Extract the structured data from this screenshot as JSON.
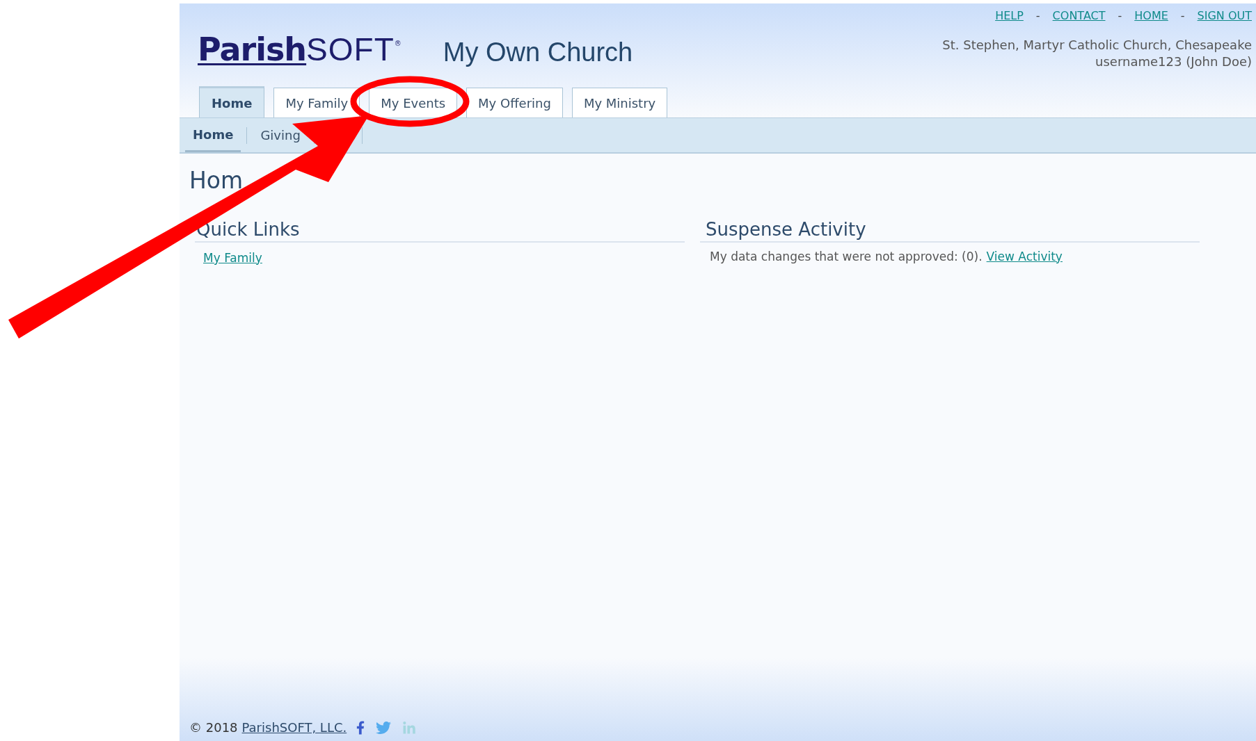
{
  "logo": {
    "part1": "Parish",
    "part2": "SOFT",
    "mark": "®"
  },
  "site_title": "My Own Church",
  "top_links": [
    {
      "kind": "link",
      "label": "HELP"
    },
    {
      "kind": "separator",
      "label": "-"
    },
    {
      "kind": "link",
      "label": "CONTACT"
    },
    {
      "kind": "separator",
      "label": "-"
    },
    {
      "kind": "link",
      "label": "HOME"
    },
    {
      "kind": "separator",
      "label": "-"
    },
    {
      "kind": "link",
      "label": "SIGN OUT"
    }
  ],
  "account": {
    "church": "St. Stephen, Martyr Catholic Church, Chesapeake",
    "user": "username123 (John Doe)"
  },
  "tabs": [
    {
      "label": "Home",
      "selected": true
    },
    {
      "label": "My Family",
      "selected": false
    },
    {
      "label": "My Events",
      "selected": false
    },
    {
      "label": "My Offering",
      "selected": false
    },
    {
      "label": "My Ministry",
      "selected": false
    }
  ],
  "subnav": [
    {
      "label": "Home",
      "selected": true
    },
    {
      "label": "Giving",
      "selected": false
    }
  ],
  "page_heading": "Hom",
  "quick_links": {
    "title": "Quick Links",
    "links": [
      "My Family"
    ]
  },
  "suspense": {
    "title": "Suspense Activity",
    "text": "My data changes that were not approved: (0).",
    "link": "View Activity"
  },
  "footer": {
    "copyright": "© 2018",
    "company_link": "ParishSOFT, LLC."
  }
}
